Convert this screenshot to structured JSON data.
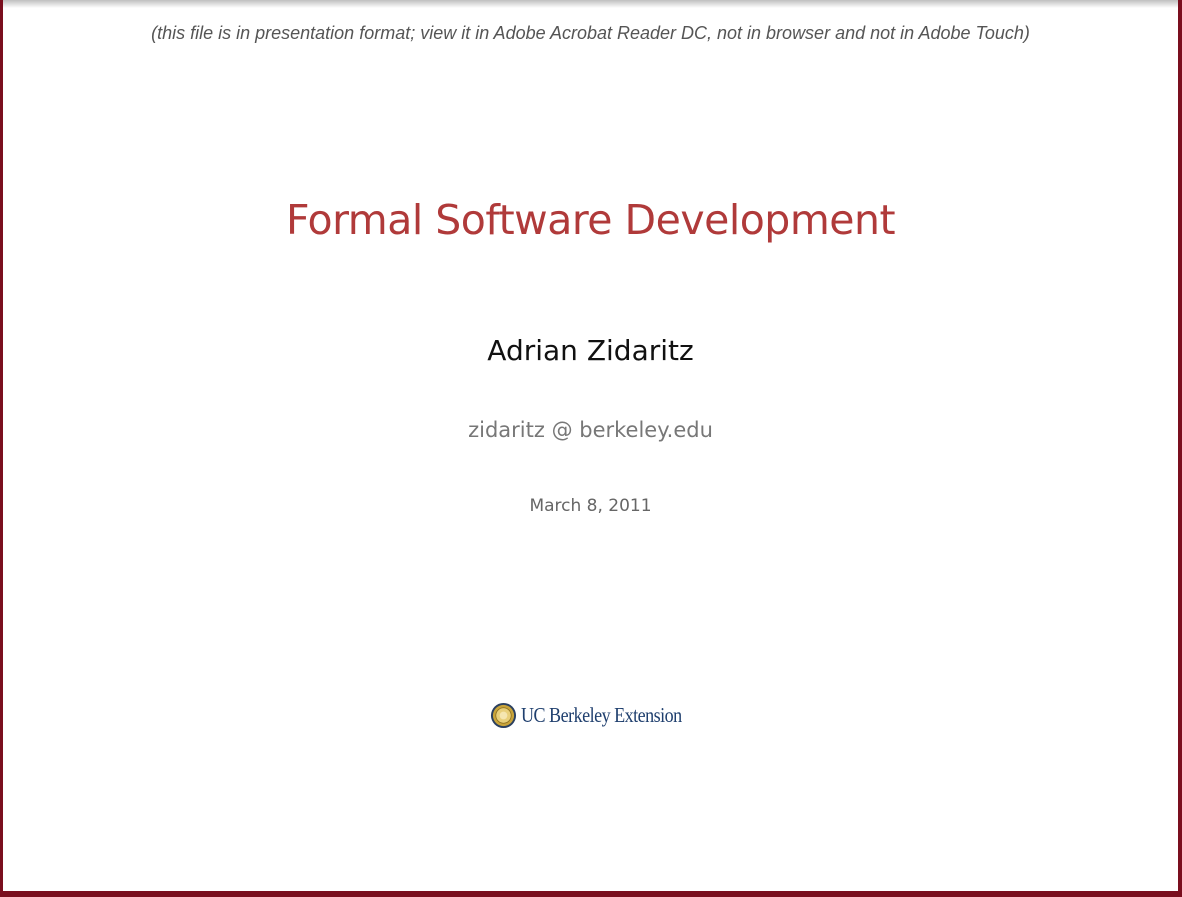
{
  "notice": "(this file is in presentation format; view it in Adobe Acrobat Reader DC, not in browser and not in Adobe Touch)",
  "slide": {
    "title": "Formal Software Development",
    "author": "Adrian Zidaritz",
    "email": "zidaritz @ berkeley.edu",
    "date": "March 8, 2011"
  },
  "logo": {
    "icon": "seal-icon",
    "text": "UC Berkeley Extension"
  },
  "colors": {
    "frame": "#7a0e1e",
    "title": "#b03a3a",
    "logo_text": "#1f3f6e",
    "seal_gold": "#c9a43a"
  }
}
